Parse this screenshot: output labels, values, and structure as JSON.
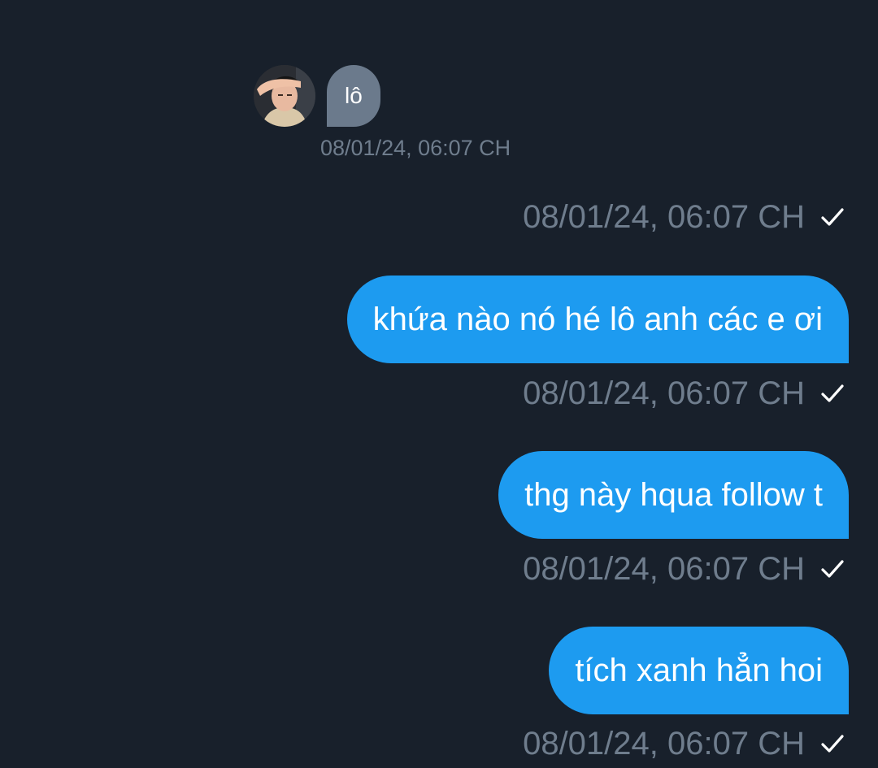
{
  "incoming": {
    "text": "lô",
    "timestamp": "08/01/24, 06:07 CH"
  },
  "outgoing": [
    {
      "timestamp": "08/01/24, 06:07 CH"
    },
    {
      "text": "khứa nào nó hé lô anh các e ơi",
      "timestamp": "08/01/24, 06:07 CH"
    },
    {
      "text": "thg này hqua follow t",
      "timestamp": "08/01/24, 06:07 CH"
    },
    {
      "text": "tích xanh hẳn hoi",
      "timestamp": "08/01/24, 06:07 CH"
    }
  ],
  "colors": {
    "background": "#18202b",
    "incoming_bubble": "#6b7a8c",
    "outgoing_bubble": "#1d9bf0",
    "timestamp_text": "#6f7d8d"
  },
  "icons": {
    "read_status": "checkmark-icon",
    "avatar": "user-avatar-photo"
  }
}
